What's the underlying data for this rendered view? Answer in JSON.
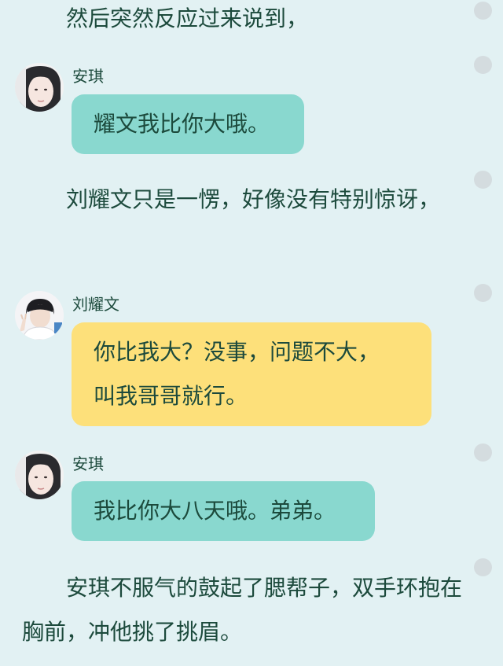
{
  "narration": [
    "然后突然反应过来说到，",
    "刘耀文只是一愣，好像没有特别惊讶，",
    "安琪不服气的鼓起了腮帮子，双手环抱在胸前，冲他挑了挑眉。"
  ],
  "messages": [
    {
      "speaker": "安琪",
      "avatar_icon": "girl-avatar-icon",
      "lines": [
        "耀文我比你大哦。"
      ],
      "bubble_color": "#89d8cf"
    },
    {
      "speaker": "刘耀文",
      "avatar_icon": "boy-avatar-icon",
      "lines": [
        "你比我大？没事，问题不大，",
        "叫我哥哥就行。"
      ],
      "bubble_color": "#fde07a"
    },
    {
      "speaker": "安琪",
      "avatar_icon": "girl-avatar-icon",
      "lines": [
        "我比你大八天哦。弟弟。"
      ],
      "bubble_color": "#89d8cf"
    }
  ],
  "colors": {
    "background": "#e2f1f3",
    "text": "#1c4a3c",
    "teal_bubble": "#89d8cf",
    "yellow_bubble": "#fde07a",
    "side_dot": "#d4dcdf"
  }
}
